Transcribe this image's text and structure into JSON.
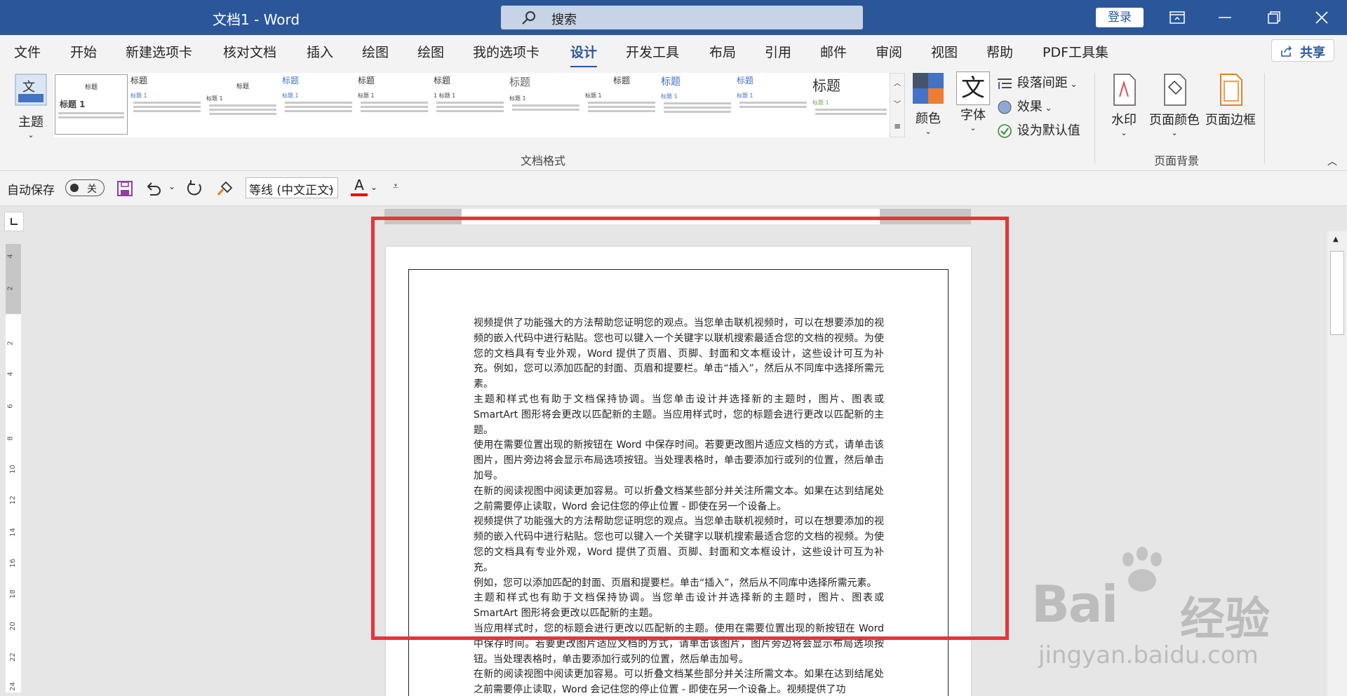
{
  "app": {
    "title": "文档1  -  Word",
    "search_placeholder": "搜索",
    "signin": "登录"
  },
  "tabs": [
    "文件",
    "开始",
    "新建选项卡",
    "核对文档",
    "插入",
    "绘图",
    "绘图",
    "我的选项卡",
    "设计",
    "开发工具",
    "布局",
    "引用",
    "邮件",
    "审阅",
    "视图",
    "帮助",
    "PDF工具集"
  ],
  "active_tab": "设计",
  "share": "共享",
  "ribbon": {
    "theme": "主题",
    "gallery_items": [
      {
        "h": "标题",
        "sub": "标题 1"
      },
      {
        "h": "标题",
        "sub": "标题 1"
      },
      {
        "h": "标题",
        "sub": "标题 1"
      },
      {
        "h": "标题",
        "sub": "标题 1"
      },
      {
        "h": "标题",
        "sub": "标题 1"
      },
      {
        "h": "标题",
        "sub": "1  标题 1"
      },
      {
        "h": "标题",
        "sub": "标题 1"
      },
      {
        "h": "标题",
        "sub": "标题 1"
      },
      {
        "h": "标题",
        "sub": "标题 1"
      },
      {
        "h": "标题",
        "sub": "标题 1"
      },
      {
        "h": "标题",
        "sub": "标题 1"
      }
    ],
    "group_doc_format": "文档格式",
    "colors": "颜色",
    "fonts": "字体",
    "paragraph_spacing": "段落间距",
    "effects": "效果",
    "set_default": "设为默认值",
    "watermark": "水印",
    "page_color": "页面颜色",
    "page_borders": "页面边框",
    "group_page_background": "页面背景"
  },
  "qat": {
    "autosave": "自动保存",
    "toggle": "关",
    "font": "等线 (中文正文)"
  },
  "ruler_v_numbers": [
    "4",
    "2",
    "2",
    "4",
    "6",
    "8",
    "10",
    "12",
    "14",
    "16",
    "18",
    "20",
    "22",
    "24"
  ],
  "document": {
    "paragraphs": [
      "视频提供了功能强大的方法帮助您证明您的观点。当您单击联机视频时，可以在想要添加的视频的嵌入代码中进行粘贴。您也可以键入一个关键字以联机搜索最适合您的文档的视频。为使您的文档具有专业外观，Word 提供了页眉、页脚、封面和文本框设计，这些设计可互为补充。例如，您可以添加匹配的封面、页眉和提要栏。单击“插入”，然后从不同库中选择所需元素。",
      "主题和样式也有助于文档保持协调。当您单击设计并选择新的主题时，图片、图表或 SmartArt 图形将会更改以匹配新的主题。当应用样式时，您的标题会进行更改以匹配新的主题。",
      "使用在需要位置出现的新按钮在 Word 中保存时间。若要更改图片适应文档的方式，请单击该图片，图片旁边将会显示布局选项按钮。当处理表格时，单击要添加行或列的位置，然后单击加号。",
      "在新的阅读视图中阅读更加容易。可以折叠文档某些部分并关注所需文本。如果在达到结尾处之前需要停止读取，Word 会记住您的停止位置 - 即使在另一个设备上。",
      "视频提供了功能强大的方法帮助您证明您的观点。当您单击联机视频时，可以在想要添加的视频的嵌入代码中进行粘贴。您也可以键入一个关键字以联机搜索最适合您的文档的视频。为使您的文档具有专业外观，Word 提供了页眉、页脚、封面和文本框设计，这些设计可互为补充。",
      "例如，您可以添加匹配的封面、页眉和提要栏。单击“插入”，然后从不同库中选择所需元素。",
      "主题和样式也有助于文档保持协调。当您单击设计并选择新的主题时，图片、图表或 SmartArt 图形将会更改以匹配新的主题。",
      "当应用样式时，您的标题会进行更改以匹配新的主题。使用在需要位置出现的新按钮在 Word 中保存时间。若要更改图片适应文档的方式，请单击该图片，图片旁边将会显示布局选项按钮。当处理表格时，单击要添加行或列的位置，然后单击加号。",
      "在新的阅读视图中阅读更加容易。可以折叠文档某些部分并关注所需文本。如果在达到结尾处之前需要停止读取，Word 会记住您的停止位置 - 即使在另一个设备上。视频提供了功"
    ]
  },
  "watermark": {
    "logo": "Bai",
    "cn": "经验",
    "url": "jingyan.baidu.com"
  },
  "colors": {
    "title_bar": "#2b579a",
    "highlight_box": "#e8333a"
  }
}
